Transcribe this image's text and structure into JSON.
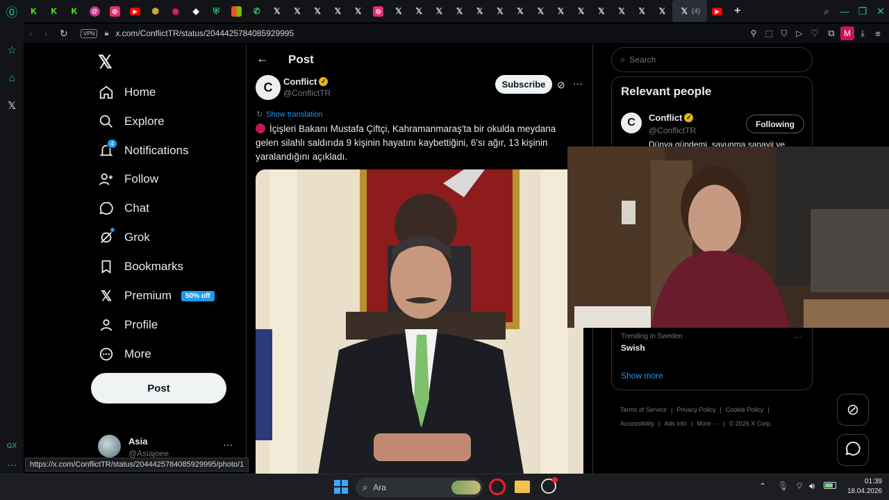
{
  "browser": {
    "url": "x.com/ConflictTR/status/2044425784085929995",
    "vpn_label": "VPN",
    "active_tab_count": "(4)",
    "profile_initial": "M",
    "hover_url": "https://x.com/ConflictTR/status/2044425784085929995/photo/1"
  },
  "nav": {
    "items": [
      {
        "label": "Home",
        "icon": "home-icon"
      },
      {
        "label": "Explore",
        "icon": "search-icon"
      },
      {
        "label": "Notifications",
        "icon": "bell-icon",
        "badge": "4"
      },
      {
        "label": "Follow",
        "icon": "person-add-icon"
      },
      {
        "label": "Chat",
        "icon": "chat-icon"
      },
      {
        "label": "Grok",
        "icon": "grok-icon"
      },
      {
        "label": "Bookmarks",
        "icon": "bookmark-icon"
      },
      {
        "label": "Premium",
        "icon": "x-icon",
        "badge": "50% off"
      },
      {
        "label": "Profile",
        "icon": "person-icon"
      },
      {
        "label": "More",
        "icon": "more-circle-icon"
      }
    ],
    "post_button": "Post",
    "account": {
      "name": "Asia",
      "handle": "@Asiajoee"
    }
  },
  "post": {
    "header": "Post",
    "author_name": "Conflict",
    "author_handle": "@ConflictTR",
    "subscribe": "Subscribe",
    "show_translation": "Show translation",
    "text": "İçişleri Bakanı Mustafa Çiftçi, Kahramanmaraş'ta bir okulda meydana gelen silahlı saldırıda 9 kişinin hayatını kaybettiğini, 6'sı ağır, 13 kişinin yaralandığını açıkladı."
  },
  "right": {
    "search_placeholder": "Search",
    "relevant_title": "Relevant people",
    "person_name": "Conflict",
    "person_handle": "@ConflictTR",
    "following": "Following",
    "person_bio": "Dünya gündemi, savunma sanayii ve",
    "trend_context": "Trending in Sweden",
    "trend_name": "Swish",
    "show_more": "Show more",
    "footer": [
      "Terms of Service",
      "Privacy Policy",
      "Cookie Policy",
      "Accessibility",
      "Ads info",
      "More ···",
      "© 2026 X Corp."
    ]
  },
  "taskbar": {
    "search": "Ara",
    "time": "01:39",
    "date": "18.04.2026"
  },
  "colors": {
    "accent": "#1d9bf0",
    "badge": "#1d9bf0",
    "gold": "#e2b719",
    "opera": "#ff1b2d"
  }
}
